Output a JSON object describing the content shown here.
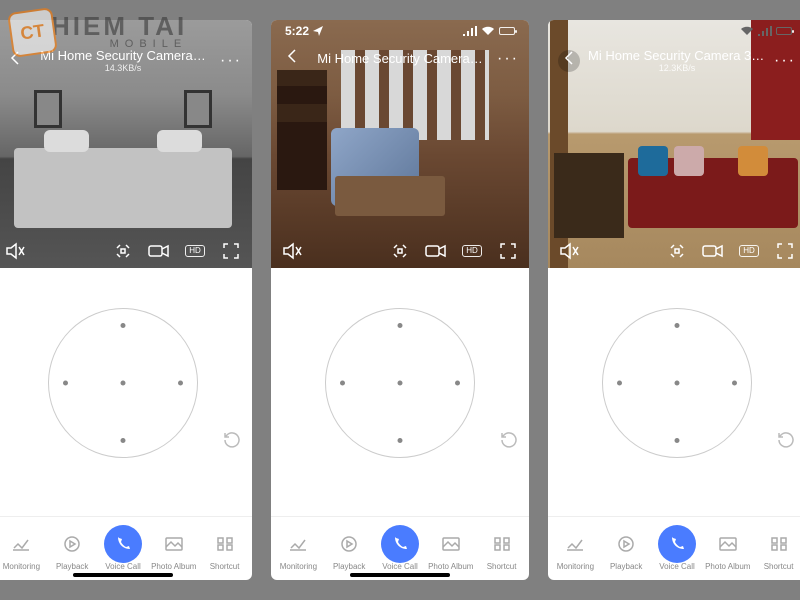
{
  "watermark": {
    "logo_text": "CT",
    "line1": "HIEM TAI",
    "line2": "MOBILE"
  },
  "phones": [
    {
      "status_time": "",
      "camera_title": "Mi Home Security Camera…",
      "data_rate": "14.3KB/s",
      "hd_label": "HD",
      "show_statusbar": false
    },
    {
      "status_time": "5:22",
      "camera_title": "Mi Home Security Camera…",
      "data_rate": "",
      "hd_label": "HD",
      "show_statusbar": true
    },
    {
      "status_time": "",
      "camera_title": "Mi Home Security Camera 36…",
      "data_rate": "12.3KB/s",
      "hd_label": "HD",
      "show_statusbar": true
    }
  ],
  "nav_labels": {
    "monitoring": "Monitoring",
    "playback": "Playback",
    "voice": "Voice Call",
    "album": "Photo Album",
    "shortcut": "Shortcut"
  }
}
